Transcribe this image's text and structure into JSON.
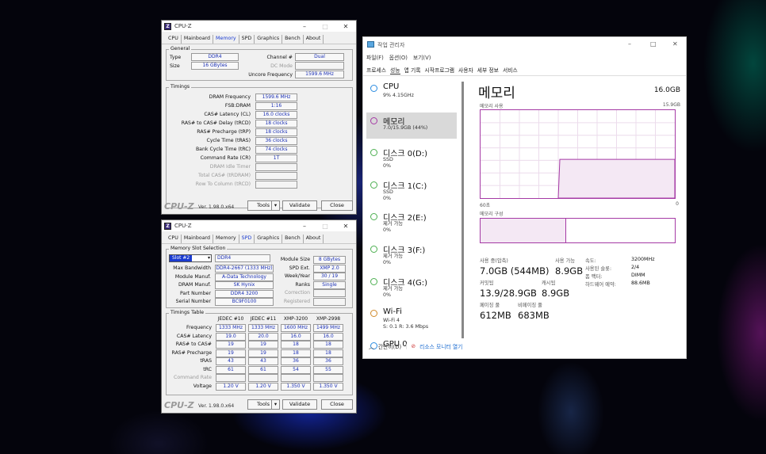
{
  "cpuz_memory": {
    "title": "CPU-Z",
    "tabs": [
      "CPU",
      "Mainboard",
      "Memory",
      "SPD",
      "Graphics",
      "Bench",
      "About"
    ],
    "general_label": "General",
    "type_label": "Type",
    "type": "DDR4",
    "size_label": "Size",
    "size": "16 GBytes",
    "channel_label": "Channel #",
    "channel": "Dual",
    "dcmode_label": "DC Mode",
    "dcmode": "",
    "uncore_label": "Uncore Frequency",
    "uncore": "1599.6 MHz",
    "timings_label": "Timings",
    "timings": [
      {
        "label": "DRAM Frequency",
        "value": "1599.6 MHz"
      },
      {
        "label": "FSB:DRAM",
        "value": "1:16"
      },
      {
        "label": "CAS# Latency (CL)",
        "value": "16.0 clocks"
      },
      {
        "label": "RAS# to CAS# Delay (tRCD)",
        "value": "18 clocks"
      },
      {
        "label": "RAS# Precharge (tRP)",
        "value": "18 clocks"
      },
      {
        "label": "Cycle Time (tRAS)",
        "value": "36 clocks"
      },
      {
        "label": "Bank Cycle Time (tRC)",
        "value": "74 clocks"
      },
      {
        "label": "Command Rate (CR)",
        "value": "1T"
      },
      {
        "label": "DRAM Idle Timer",
        "value": ""
      },
      {
        "label": "Total CAS# (tRDRAM)",
        "value": ""
      },
      {
        "label": "Row To Column (tRCD)",
        "value": ""
      }
    ],
    "logo": "CPU-Z",
    "version": "Ver. 1.98.0.x64",
    "tools": "Tools",
    "validate": "Validate",
    "close": "Close"
  },
  "cpuz_spd": {
    "title": "CPU-Z",
    "tabs": [
      "CPU",
      "Mainboard",
      "Memory",
      "SPD",
      "Graphics",
      "Bench",
      "About"
    ],
    "group_label": "Memory Slot Selection",
    "slot": "Slot #2",
    "slot_type": "DDR4",
    "module_size_label": "Module Size",
    "module_size": "8 GBytes",
    "max_bw_label": "Max Bandwidth",
    "max_bw": "DDR4-2667 (1333 MHz)",
    "spd_ext_label": "SPD Ext.",
    "spd_ext": "XMP 2.0",
    "manuf_label": "Module Manuf.",
    "manuf": "A-Data Technology",
    "week_label": "Week/Year",
    "week": "30 / 19",
    "dram_manuf_label": "DRAM Manuf.",
    "dram_manuf": "SK Hynix",
    "ranks_label": "Ranks",
    "ranks": "Single",
    "part_label": "Part Number",
    "part": "DDR4 3200",
    "correction_label": "Correction",
    "correction": "",
    "serial_label": "Serial Number",
    "serial": "BC9F0100",
    "registered_label": "Registered",
    "registered": "",
    "table_label": "Timings Table",
    "cols": [
      "JEDEC #10",
      "JEDEC #11",
      "XMP-3200",
      "XMP-2998"
    ],
    "rows": [
      {
        "label": "Frequency",
        "values": [
          "1333 MHz",
          "1333 MHz",
          "1600 MHz",
          "1499 MHz"
        ]
      },
      {
        "label": "CAS# Latency",
        "values": [
          "19.0",
          "20.0",
          "16.0",
          "16.0"
        ]
      },
      {
        "label": "RAS# to CAS#",
        "values": [
          "19",
          "19",
          "18",
          "18"
        ]
      },
      {
        "label": "RAS# Precharge",
        "values": [
          "19",
          "19",
          "18",
          "18"
        ]
      },
      {
        "label": "tRAS",
        "values": [
          "43",
          "43",
          "36",
          "36"
        ]
      },
      {
        "label": "tRC",
        "values": [
          "61",
          "61",
          "54",
          "55"
        ]
      },
      {
        "label": "Command Rate",
        "values": [
          "",
          "",
          "",
          ""
        ]
      },
      {
        "label": "Voltage",
        "values": [
          "1.20 V",
          "1.20 V",
          "1.350 V",
          "1.350 V"
        ]
      }
    ],
    "logo": "CPU-Z",
    "version": "Ver. 1.98.0.x64",
    "tools": "Tools",
    "validate": "Validate",
    "close": "Close"
  },
  "taskmgr": {
    "title": "작업 관리자",
    "menu": [
      "파일(F)",
      "옵션(O)",
      "보기(V)"
    ],
    "tabs": [
      "프로세스",
      "성능",
      "앱 기록",
      "시작프로그램",
      "사용자",
      "세부 정보",
      "서비스"
    ],
    "side": [
      {
        "name": "CPU",
        "sub": "9% 4.15GHz",
        "color": "#2a8be0"
      },
      {
        "name": "메모리",
        "sub": "7.0/15.9GB (44%)",
        "color": "#a53aa5"
      },
      {
        "name": "디스크 0(D:)",
        "sub": "SSD\n0%",
        "color": "#4caf50"
      },
      {
        "name": "디스크 1(C:)",
        "sub": "SSD\n0%",
        "color": "#4caf50"
      },
      {
        "name": "디스크 2(E:)",
        "sub": "제거 가능\n0%",
        "color": "#4caf50"
      },
      {
        "name": "디스크 3(F:)",
        "sub": "제거 가능\n0%",
        "color": "#4caf50"
      },
      {
        "name": "디스크 4(G:)",
        "sub": "제거 가능\n0%",
        "color": "#4caf50"
      },
      {
        "name": "Wi-Fi",
        "sub": "Wi-Fi 4\nS: 0.1 R: 3.6 Mbps",
        "color": "#d08a2a"
      },
      {
        "name": "GPU 0",
        "sub": "",
        "color": "#2a8be0"
      }
    ],
    "main_title": "메모리",
    "total": "16.0GB",
    "usage_label": "메모리 사용",
    "usage_max": "15.9GB",
    "time_label": "60초",
    "time_end": "0",
    "usage_fraction": 0.44,
    "comp_label": "메모리 구성",
    "in_use_label": "사용 중(압축)",
    "in_use": "7.0GB (544MB)",
    "avail_label": "사용 가능",
    "avail": "8.9GB",
    "committed_label": "커밋됨",
    "committed": "13.9/28.9GB",
    "cached_label": "캐시됨",
    "cached": "8.9GB",
    "paged_label": "페이징 풀",
    "paged": "612MB",
    "nonpaged_label": "비페이징 풀",
    "nonpaged": "683MB",
    "speed_label": "속도:",
    "speed": "3200MHz",
    "slots_label": "사용된 슬롯:",
    "slots": "2/4",
    "form_label": "폼 팩터:",
    "form": "DIMM",
    "reserved_label": "하드웨어 예약:",
    "reserved": "88.6MB",
    "collapse": "간단히(D)",
    "resmon": "리소스 모니터 열기"
  }
}
